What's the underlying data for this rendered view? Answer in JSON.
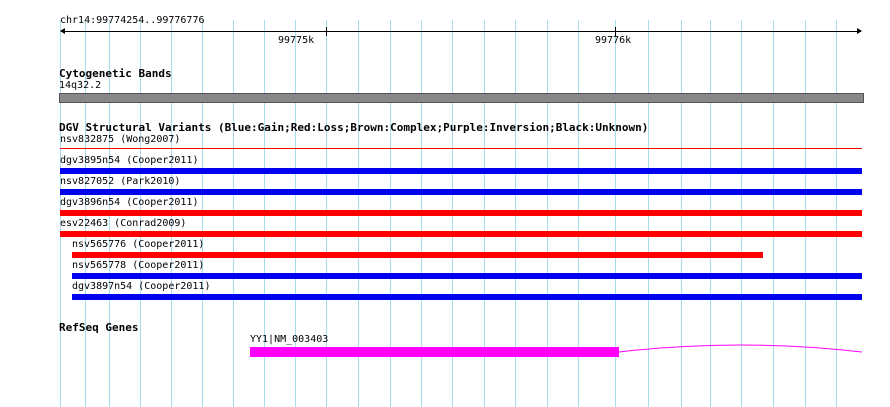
{
  "ruler": {
    "region": "chr14:99774254..99776776",
    "tick_labels": [
      "99775k",
      "99776k"
    ]
  },
  "cytoband_track": {
    "title": "Cytogenetic Bands",
    "band_label": "14q32.2",
    "band_color": "#888888"
  },
  "dgv_track": {
    "title": "DGV Structural Variants (Blue:Gain;Red:Loss;Brown:Complex;Purple:Inversion;Black:Unknown)",
    "colors": {
      "gain": "#0000ee",
      "loss": "#ff0000"
    },
    "variants": [
      {
        "label": "nsv832875 (Wong2007)",
        "type": "loss"
      },
      {
        "label": "dgv3895n54 (Cooper2011)",
        "type": "gain"
      },
      {
        "label": "nsv827052 (Park2010)",
        "type": "gain"
      },
      {
        "label": "dgv3896n54 (Cooper2011)",
        "type": "loss"
      },
      {
        "label": "esv22463 (Conrad2009)",
        "type": "loss"
      },
      {
        "label": "nsv565776 (Cooper2011)",
        "type": "loss"
      },
      {
        "label": "nsv565778 (Cooper2011)",
        "type": "gain"
      },
      {
        "label": "dgv3897n54 (Cooper2011)",
        "type": "gain"
      }
    ]
  },
  "refseq_track": {
    "title": "RefSeq Genes",
    "gene_label": "YY1|NM_003403",
    "gene_color": "#ff00ff"
  }
}
